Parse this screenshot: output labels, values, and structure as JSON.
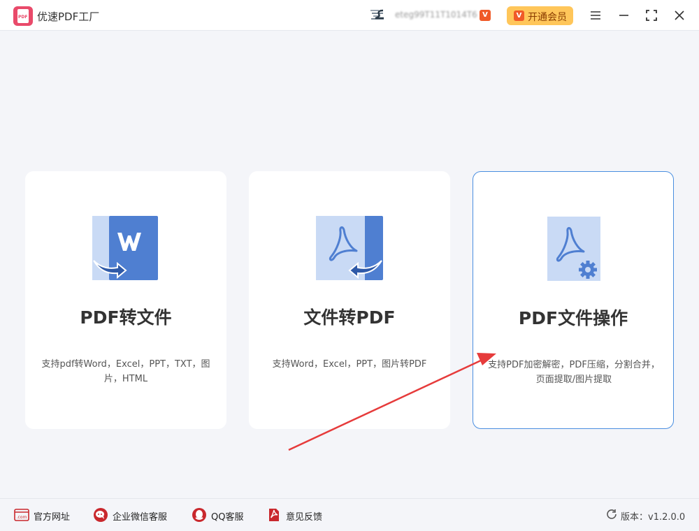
{
  "app": {
    "title": "优速PDF工厂",
    "logo_text": "PDF"
  },
  "header": {
    "user_name": "eteg99T11T1014T6",
    "vip_button_label": "开通会员",
    "vip_mark": "V"
  },
  "cards": [
    {
      "title": "PDF转文件",
      "description": "支持pdf转Word，Excel，PPT，TXT，图片，HTML",
      "icon": "pdf-to-word-icon"
    },
    {
      "title": "文件转PDF",
      "description": "支持Word，Excel，PPT，图片转PDF",
      "icon": "file-to-pdf-icon"
    },
    {
      "title": "PDF文件操作",
      "description": "支持PDF加密解密，PDF压缩，分割合并，页面提取/图片提取",
      "icon": "pdf-settings-icon"
    }
  ],
  "footer": {
    "items": [
      {
        "label": "官方网址",
        "icon": "website-icon"
      },
      {
        "label": "企业微信客服",
        "icon": "wechat-service-icon"
      },
      {
        "label": "QQ客服",
        "icon": "qq-icon"
      },
      {
        "label": "意见反馈",
        "icon": "feedback-icon"
      }
    ],
    "version": "版本：v1.2.0.0"
  },
  "colors": {
    "accent": "#4a8ee0",
    "brand": "#e94a6a",
    "vip": "#ffc65a",
    "annotation": "#e63b3b"
  }
}
